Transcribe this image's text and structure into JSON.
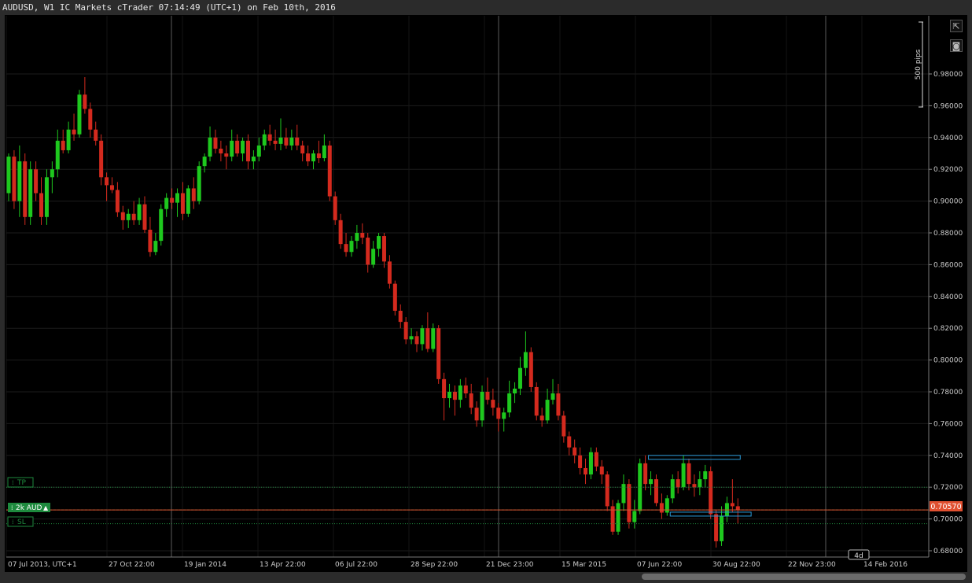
{
  "window": {
    "title": "AUDUSD, W1 IC Markets cTrader 07:14:49 (UTC+1) on Feb 10th, 2016"
  },
  "toolbar": {
    "pips_label": "500 pips",
    "popout_icon": "popout-icon",
    "camera_icon": "camera-icon"
  },
  "orders": {
    "tp_label": "TP",
    "position_label": "2k AUD",
    "sl_label": "SL",
    "current_price": "0.70570"
  },
  "time_marker": "4d",
  "colors": {
    "bull": "#1ec81e",
    "bear": "#d42a1e",
    "price_line": "#e05030",
    "zone": "#2a9ad8"
  },
  "chart_data": {
    "type": "candlestick",
    "timeframe": "W1",
    "ylim": [
      0.675,
      0.99
    ],
    "y_ticks": [
      "0.98000",
      "0.96000",
      "0.94000",
      "0.92000",
      "0.90000",
      "0.88000",
      "0.86000",
      "0.84000",
      "0.82000",
      "0.80000",
      "0.78000",
      "0.76000",
      "0.74000",
      "0.72000",
      "0.70000",
      "0.68000"
    ],
    "x_labels": [
      "07 Jul 2013, UTC+1",
      "27 Oct 22:00",
      "19 Jan 2014",
      "13 Apr 22:00",
      "06 Jul 22:00",
      "28 Sep 22:00",
      "21 Dec 23:00",
      "15 Mar 2015",
      "07 Jun 22:00",
      "30 Aug 22:00",
      "22 Nov 23:00",
      "14 Feb 2016"
    ],
    "levels": {
      "tp": 0.72,
      "position": 0.7057,
      "sl": 0.697,
      "current": 0.7057
    },
    "zones": [
      {
        "from_index": 118,
        "to_index": 134,
        "price": 0.7385
      },
      {
        "from_index": 122,
        "to_index": 136,
        "price": 0.7028
      }
    ],
    "candles": [
      {
        "o": 0.905,
        "h": 0.93,
        "l": 0.9,
        "c": 0.928
      },
      {
        "o": 0.928,
        "h": 0.932,
        "l": 0.895,
        "c": 0.9
      },
      {
        "o": 0.9,
        "h": 0.935,
        "l": 0.89,
        "c": 0.925
      },
      {
        "o": 0.925,
        "h": 0.93,
        "l": 0.885,
        "c": 0.89
      },
      {
        "o": 0.89,
        "h": 0.925,
        "l": 0.885,
        "c": 0.92
      },
      {
        "o": 0.92,
        "h": 0.925,
        "l": 0.9,
        "c": 0.905
      },
      {
        "o": 0.905,
        "h": 0.915,
        "l": 0.885,
        "c": 0.89
      },
      {
        "o": 0.89,
        "h": 0.92,
        "l": 0.885,
        "c": 0.915
      },
      {
        "o": 0.915,
        "h": 0.925,
        "l": 0.905,
        "c": 0.92
      },
      {
        "o": 0.92,
        "h": 0.945,
        "l": 0.915,
        "c": 0.938
      },
      {
        "o": 0.938,
        "h": 0.945,
        "l": 0.93,
        "c": 0.932
      },
      {
        "o": 0.932,
        "h": 0.95,
        "l": 0.93,
        "c": 0.945
      },
      {
        "o": 0.945,
        "h": 0.955,
        "l": 0.938,
        "c": 0.942
      },
      {
        "o": 0.942,
        "h": 0.97,
        "l": 0.94,
        "c": 0.967
      },
      {
        "o": 0.967,
        "h": 0.978,
        "l": 0.955,
        "c": 0.958
      },
      {
        "o": 0.958,
        "h": 0.962,
        "l": 0.94,
        "c": 0.945
      },
      {
        "o": 0.945,
        "h": 0.95,
        "l": 0.935,
        "c": 0.938
      },
      {
        "o": 0.938,
        "h": 0.942,
        "l": 0.91,
        "c": 0.915
      },
      {
        "o": 0.915,
        "h": 0.918,
        "l": 0.9,
        "c": 0.91
      },
      {
        "o": 0.91,
        "h": 0.915,
        "l": 0.905,
        "c": 0.907
      },
      {
        "o": 0.907,
        "h": 0.912,
        "l": 0.89,
        "c": 0.893
      },
      {
        "o": 0.893,
        "h": 0.897,
        "l": 0.882,
        "c": 0.888
      },
      {
        "o": 0.888,
        "h": 0.895,
        "l": 0.883,
        "c": 0.892
      },
      {
        "o": 0.892,
        "h": 0.9,
        "l": 0.885,
        "c": 0.888
      },
      {
        "o": 0.888,
        "h": 0.902,
        "l": 0.885,
        "c": 0.898
      },
      {
        "o": 0.898,
        "h": 0.903,
        "l": 0.88,
        "c": 0.882
      },
      {
        "o": 0.882,
        "h": 0.89,
        "l": 0.865,
        "c": 0.868
      },
      {
        "o": 0.868,
        "h": 0.88,
        "l": 0.866,
        "c": 0.875
      },
      {
        "o": 0.875,
        "h": 0.898,
        "l": 0.872,
        "c": 0.895
      },
      {
        "o": 0.895,
        "h": 0.905,
        "l": 0.89,
        "c": 0.902
      },
      {
        "o": 0.902,
        "h": 0.908,
        "l": 0.895,
        "c": 0.899
      },
      {
        "o": 0.899,
        "h": 0.908,
        "l": 0.89,
        "c": 0.905
      },
      {
        "o": 0.905,
        "h": 0.912,
        "l": 0.888,
        "c": 0.892
      },
      {
        "o": 0.892,
        "h": 0.91,
        "l": 0.89,
        "c": 0.908
      },
      {
        "o": 0.908,
        "h": 0.915,
        "l": 0.895,
        "c": 0.9
      },
      {
        "o": 0.9,
        "h": 0.925,
        "l": 0.898,
        "c": 0.922
      },
      {
        "o": 0.922,
        "h": 0.93,
        "l": 0.918,
        "c": 0.928
      },
      {
        "o": 0.928,
        "h": 0.947,
        "l": 0.925,
        "c": 0.94
      },
      {
        "o": 0.94,
        "h": 0.945,
        "l": 0.93,
        "c": 0.933
      },
      {
        "o": 0.933,
        "h": 0.938,
        "l": 0.925,
        "c": 0.93
      },
      {
        "o": 0.93,
        "h": 0.935,
        "l": 0.92,
        "c": 0.928
      },
      {
        "o": 0.928,
        "h": 0.945,
        "l": 0.925,
        "c": 0.938
      },
      {
        "o": 0.938,
        "h": 0.942,
        "l": 0.928,
        "c": 0.93
      },
      {
        "o": 0.93,
        "h": 0.94,
        "l": 0.925,
        "c": 0.938
      },
      {
        "o": 0.938,
        "h": 0.942,
        "l": 0.92,
        "c": 0.925
      },
      {
        "o": 0.925,
        "h": 0.932,
        "l": 0.92,
        "c": 0.928
      },
      {
        "o": 0.928,
        "h": 0.94,
        "l": 0.925,
        "c": 0.935
      },
      {
        "o": 0.935,
        "h": 0.945,
        "l": 0.932,
        "c": 0.942
      },
      {
        "o": 0.942,
        "h": 0.948,
        "l": 0.935,
        "c": 0.938
      },
      {
        "o": 0.938,
        "h": 0.945,
        "l": 0.932,
        "c": 0.936
      },
      {
        "o": 0.936,
        "h": 0.952,
        "l": 0.932,
        "c": 0.94
      },
      {
        "o": 0.94,
        "h": 0.946,
        "l": 0.933,
        "c": 0.935
      },
      {
        "o": 0.935,
        "h": 0.945,
        "l": 0.932,
        "c": 0.94
      },
      {
        "o": 0.94,
        "h": 0.948,
        "l": 0.932,
        "c": 0.935
      },
      {
        "o": 0.935,
        "h": 0.938,
        "l": 0.925,
        "c": 0.93
      },
      {
        "o": 0.93,
        "h": 0.935,
        "l": 0.922,
        "c": 0.925
      },
      {
        "o": 0.925,
        "h": 0.932,
        "l": 0.92,
        "c": 0.93
      },
      {
        "o": 0.93,
        "h": 0.938,
        "l": 0.924,
        "c": 0.927
      },
      {
        "o": 0.927,
        "h": 0.942,
        "l": 0.925,
        "c": 0.935
      },
      {
        "o": 0.935,
        "h": 0.938,
        "l": 0.9,
        "c": 0.903
      },
      {
        "o": 0.903,
        "h": 0.906,
        "l": 0.885,
        "c": 0.888
      },
      {
        "o": 0.888,
        "h": 0.892,
        "l": 0.87,
        "c": 0.873
      },
      {
        "o": 0.873,
        "h": 0.88,
        "l": 0.865,
        "c": 0.868
      },
      {
        "o": 0.868,
        "h": 0.878,
        "l": 0.865,
        "c": 0.875
      },
      {
        "o": 0.875,
        "h": 0.885,
        "l": 0.87,
        "c": 0.88
      },
      {
        "o": 0.88,
        "h": 0.886,
        "l": 0.873,
        "c": 0.877
      },
      {
        "o": 0.877,
        "h": 0.88,
        "l": 0.855,
        "c": 0.86
      },
      {
        "o": 0.86,
        "h": 0.875,
        "l": 0.858,
        "c": 0.87
      },
      {
        "o": 0.87,
        "h": 0.88,
        "l": 0.865,
        "c": 0.878
      },
      {
        "o": 0.878,
        "h": 0.88,
        "l": 0.858,
        "c": 0.862
      },
      {
        "o": 0.862,
        "h": 0.866,
        "l": 0.845,
        "c": 0.848
      },
      {
        "o": 0.848,
        "h": 0.85,
        "l": 0.828,
        "c": 0.831
      },
      {
        "o": 0.831,
        "h": 0.835,
        "l": 0.82,
        "c": 0.824
      },
      {
        "o": 0.824,
        "h": 0.827,
        "l": 0.81,
        "c": 0.813
      },
      {
        "o": 0.813,
        "h": 0.82,
        "l": 0.81,
        "c": 0.815
      },
      {
        "o": 0.815,
        "h": 0.818,
        "l": 0.805,
        "c": 0.81
      },
      {
        "o": 0.81,
        "h": 0.822,
        "l": 0.806,
        "c": 0.82
      },
      {
        "o": 0.82,
        "h": 0.83,
        "l": 0.805,
        "c": 0.807
      },
      {
        "o": 0.807,
        "h": 0.823,
        "l": 0.805,
        "c": 0.82
      },
      {
        "o": 0.82,
        "h": 0.822,
        "l": 0.785,
        "c": 0.788
      },
      {
        "o": 0.788,
        "h": 0.792,
        "l": 0.762,
        "c": 0.776
      },
      {
        "o": 0.776,
        "h": 0.785,
        "l": 0.77,
        "c": 0.78
      },
      {
        "o": 0.78,
        "h": 0.784,
        "l": 0.765,
        "c": 0.775
      },
      {
        "o": 0.775,
        "h": 0.788,
        "l": 0.77,
        "c": 0.784
      },
      {
        "o": 0.784,
        "h": 0.789,
        "l": 0.776,
        "c": 0.779
      },
      {
        "o": 0.779,
        "h": 0.785,
        "l": 0.766,
        "c": 0.77
      },
      {
        "o": 0.77,
        "h": 0.774,
        "l": 0.758,
        "c": 0.762
      },
      {
        "o": 0.762,
        "h": 0.784,
        "l": 0.758,
        "c": 0.78
      },
      {
        "o": 0.78,
        "h": 0.789,
        "l": 0.772,
        "c": 0.775
      },
      {
        "o": 0.775,
        "h": 0.782,
        "l": 0.765,
        "c": 0.77
      },
      {
        "o": 0.77,
        "h": 0.773,
        "l": 0.755,
        "c": 0.763
      },
      {
        "o": 0.763,
        "h": 0.77,
        "l": 0.755,
        "c": 0.767
      },
      {
        "o": 0.767,
        "h": 0.787,
        "l": 0.764,
        "c": 0.779
      },
      {
        "o": 0.779,
        "h": 0.786,
        "l": 0.773,
        "c": 0.782
      },
      {
        "o": 0.782,
        "h": 0.802,
        "l": 0.778,
        "c": 0.795
      },
      {
        "o": 0.795,
        "h": 0.818,
        "l": 0.79,
        "c": 0.805
      },
      {
        "o": 0.805,
        "h": 0.808,
        "l": 0.78,
        "c": 0.783
      },
      {
        "o": 0.783,
        "h": 0.786,
        "l": 0.762,
        "c": 0.765
      },
      {
        "o": 0.765,
        "h": 0.77,
        "l": 0.758,
        "c": 0.762
      },
      {
        "o": 0.762,
        "h": 0.782,
        "l": 0.76,
        "c": 0.775
      },
      {
        "o": 0.775,
        "h": 0.788,
        "l": 0.772,
        "c": 0.779
      },
      {
        "o": 0.779,
        "h": 0.785,
        "l": 0.762,
        "c": 0.765
      },
      {
        "o": 0.765,
        "h": 0.768,
        "l": 0.748,
        "c": 0.752
      },
      {
        "o": 0.752,
        "h": 0.755,
        "l": 0.74,
        "c": 0.745
      },
      {
        "o": 0.745,
        "h": 0.75,
        "l": 0.735,
        "c": 0.74
      },
      {
        "o": 0.74,
        "h": 0.745,
        "l": 0.728,
        "c": 0.732
      },
      {
        "o": 0.732,
        "h": 0.738,
        "l": 0.722,
        "c": 0.728
      },
      {
        "o": 0.728,
        "h": 0.745,
        "l": 0.725,
        "c": 0.742
      },
      {
        "o": 0.742,
        "h": 0.745,
        "l": 0.73,
        "c": 0.733
      },
      {
        "o": 0.733,
        "h": 0.737,
        "l": 0.722,
        "c": 0.728
      },
      {
        "o": 0.728,
        "h": 0.73,
        "l": 0.705,
        "c": 0.708
      },
      {
        "o": 0.708,
        "h": 0.712,
        "l": 0.69,
        "c": 0.692
      },
      {
        "o": 0.692,
        "h": 0.712,
        "l": 0.69,
        "c": 0.71
      },
      {
        "o": 0.71,
        "h": 0.728,
        "l": 0.705,
        "c": 0.722
      },
      {
        "o": 0.722,
        "h": 0.725,
        "l": 0.694,
        "c": 0.698
      },
      {
        "o": 0.698,
        "h": 0.712,
        "l": 0.694,
        "c": 0.705
      },
      {
        "o": 0.705,
        "h": 0.738,
        "l": 0.703,
        "c": 0.735
      },
      {
        "o": 0.735,
        "h": 0.74,
        "l": 0.718,
        "c": 0.722
      },
      {
        "o": 0.722,
        "h": 0.73,
        "l": 0.715,
        "c": 0.725
      },
      {
        "o": 0.725,
        "h": 0.728,
        "l": 0.708,
        "c": 0.71
      },
      {
        "o": 0.71,
        "h": 0.716,
        "l": 0.7,
        "c": 0.704
      },
      {
        "o": 0.704,
        "h": 0.715,
        "l": 0.702,
        "c": 0.713
      },
      {
        "o": 0.713,
        "h": 0.728,
        "l": 0.71,
        "c": 0.725
      },
      {
        "o": 0.725,
        "h": 0.73,
        "l": 0.716,
        "c": 0.72
      },
      {
        "o": 0.72,
        "h": 0.74,
        "l": 0.718,
        "c": 0.735
      },
      {
        "o": 0.735,
        "h": 0.738,
        "l": 0.718,
        "c": 0.722
      },
      {
        "o": 0.722,
        "h": 0.728,
        "l": 0.714,
        "c": 0.72
      },
      {
        "o": 0.72,
        "h": 0.73,
        "l": 0.715,
        "c": 0.725
      },
      {
        "o": 0.725,
        "h": 0.734,
        "l": 0.72,
        "c": 0.73
      },
      {
        "o": 0.73,
        "h": 0.733,
        "l": 0.7,
        "c": 0.703
      },
      {
        "o": 0.703,
        "h": 0.706,
        "l": 0.682,
        "c": 0.686
      },
      {
        "o": 0.686,
        "h": 0.708,
        "l": 0.683,
        "c": 0.702
      },
      {
        "o": 0.702,
        "h": 0.714,
        "l": 0.698,
        "c": 0.71
      },
      {
        "o": 0.71,
        "h": 0.725,
        "l": 0.704,
        "c": 0.708
      },
      {
        "o": 0.708,
        "h": 0.713,
        "l": 0.697,
        "c": 0.7057
      }
    ]
  }
}
